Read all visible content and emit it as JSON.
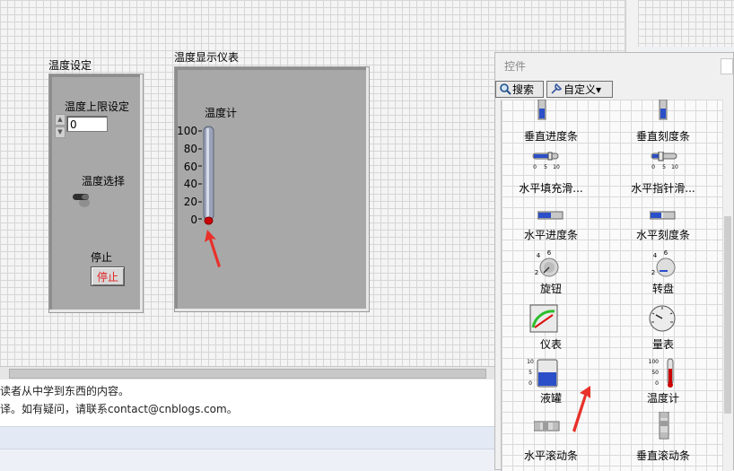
{
  "front_panel": {
    "cluster1": {
      "title": "温度设定",
      "upper_limit_label": "温度上限设定",
      "upper_limit_value": "0",
      "select_label": "温度选择",
      "stop_label": "停止",
      "stop_button": "停止"
    },
    "cluster2": {
      "title": "温度显示仪表",
      "thermometer_label": "温度计",
      "scale": [
        "100",
        "80",
        "60",
        "40",
        "20",
        "0"
      ],
      "value": 0
    }
  },
  "web_text": {
    "line1": "读者从中学到东西的内容。",
    "line2": "译。如有疑问，请联系contact@cnblogs.com。"
  },
  "palette": {
    "title": "控件",
    "search_button": "搜索",
    "custom_button": "自定义▾",
    "items": [
      {
        "label": "垂直进度条",
        "icon": "vertical-progress-bar-icon"
      },
      {
        "label": "垂直刻度条",
        "icon": "vertical-graduated-bar-icon"
      },
      {
        "label": "水平填充滑...",
        "icon": "horizontal-fill-slide-icon"
      },
      {
        "label": "水平指针滑...",
        "icon": "horizontal-pointer-slide-icon"
      },
      {
        "label": "水平进度条",
        "icon": "horizontal-progress-bar-icon"
      },
      {
        "label": "水平刻度条",
        "icon": "horizontal-graduated-bar-icon"
      },
      {
        "label": "旋钮",
        "icon": "knob-icon"
      },
      {
        "label": "转盘",
        "icon": "dial-icon"
      },
      {
        "label": "仪表",
        "icon": "meter-icon"
      },
      {
        "label": "量表",
        "icon": "gauge-icon"
      },
      {
        "label": "液罐",
        "icon": "tank-icon"
      },
      {
        "label": "温度计",
        "icon": "thermometer-icon"
      },
      {
        "label": "水平滚动条",
        "icon": "horizontal-scrollbar-icon"
      },
      {
        "label": "垂直滚动条",
        "icon": "vertical-scrollbar-icon"
      }
    ],
    "slide_ticks": [
      "0",
      "5",
      "10"
    ],
    "knob_ticks": [
      "2",
      "4",
      "6"
    ],
    "tank_ticks": [
      "10",
      "5",
      "0"
    ],
    "thermo_ticks": [
      "100",
      "50",
      "0"
    ]
  },
  "colors": {
    "stop_text": "#e21f1f",
    "mercury": "#cc0000",
    "arrow": "#e8312a",
    "progress_blue": "#2a4fc8"
  }
}
